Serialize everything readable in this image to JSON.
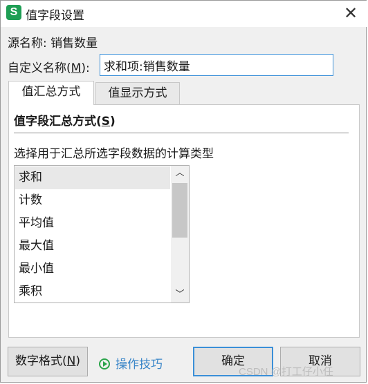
{
  "window": {
    "app_icon_letter": "S",
    "title": "值字段设置"
  },
  "source": {
    "label": "源名称:",
    "value": "销售数量"
  },
  "custom_name": {
    "label_prefix": "自定义名称(",
    "label_key": "M",
    "label_suffix": "):",
    "value": "求和项:销售数量"
  },
  "tabs": [
    {
      "label": "值汇总方式",
      "active": true
    },
    {
      "label": "值显示方式",
      "active": false
    }
  ],
  "summary_panel": {
    "title_prefix": "值字段汇总方式(",
    "title_key": "S",
    "title_suffix": ")",
    "description": "选择用于汇总所选字段数据的计算类型",
    "options": [
      "求和",
      "计数",
      "平均值",
      "最大值",
      "最小值",
      "乘积"
    ],
    "selected": "求和"
  },
  "buttons": {
    "format_prefix": "数字格式(",
    "format_key": "N",
    "format_suffix": ")",
    "tips": "操作技巧",
    "ok": "确定",
    "cancel": "取消"
  },
  "watermark": "CSDN @打工仔小任",
  "colors": {
    "app_icon": "#1e9e54",
    "accent": "#3a8fd8",
    "link": "#3a86c8"
  }
}
